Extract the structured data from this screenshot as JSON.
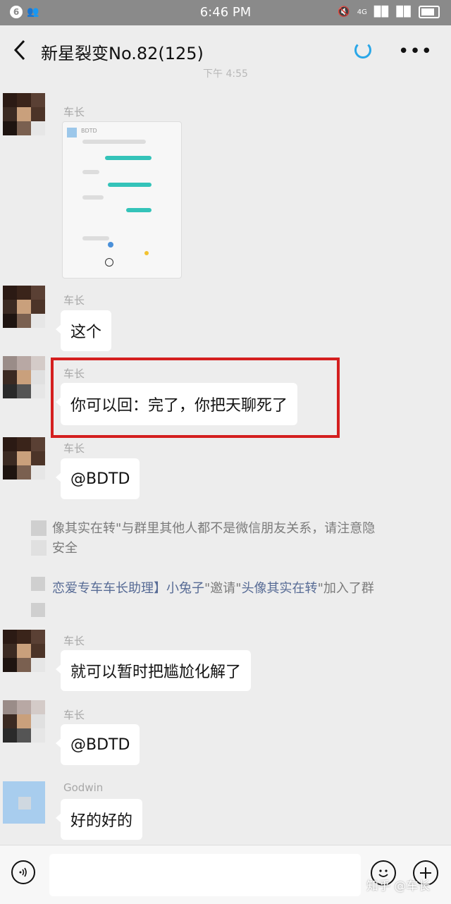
{
  "status_bar": {
    "notification_count": "6",
    "time": "6:46 PM",
    "network": "4G"
  },
  "header": {
    "back_icon": "chevron-left-icon",
    "title": "新星裂变No.82(125)",
    "more_icon": "ellipsis-icon"
  },
  "chat": {
    "timestamp": "下午 4:55",
    "messages": [
      {
        "sender": "车长",
        "type": "image"
      },
      {
        "sender": "车长",
        "text": "这个"
      },
      {
        "sender": "车长",
        "text": "你可以回：完了，你把天聊死了"
      },
      {
        "sender": "车长",
        "text": "@BDTD"
      },
      {
        "sender": "车长",
        "text": "就可以暂时把尴尬化解了"
      },
      {
        "sender": "车长",
        "text": "@BDTD"
      },
      {
        "sender": "Godwin",
        "text": "好的好的"
      }
    ],
    "system_notices": {
      "notice1_line1": "像其实在转\"与群里其他人都不是微信朋友关系，请注意隐",
      "notice1_line2": "安全",
      "notice2_part1": "恋爱专车车长助理】",
      "notice2_part2": "小兔子",
      "notice2_part3": "\"邀请\"",
      "notice2_part4": "头像其实在转",
      "notice2_part5": "\"加入了群"
    },
    "thumbnail_label": "BDTD"
  },
  "input_bar": {
    "voice_icon": "voice-icon",
    "emoji_icon": "emoji-icon",
    "plus_icon": "plus-icon",
    "input_value": ""
  },
  "watermark": "知乎 @车长",
  "colors": {
    "highlight": "#d41f1f",
    "link": "#576b95",
    "background": "#ededed"
  }
}
